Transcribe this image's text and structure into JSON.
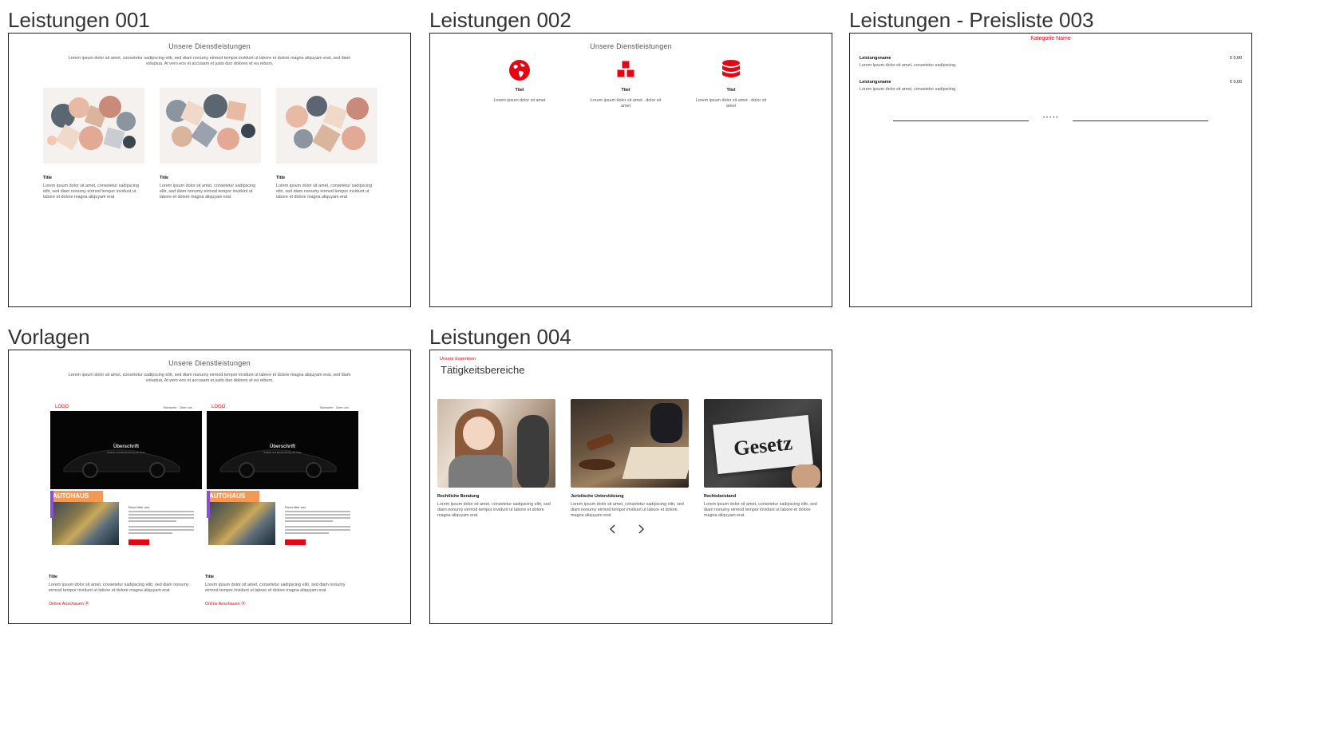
{
  "tiles": [
    {
      "title": "Leistungen 001"
    },
    {
      "title": "Leistungen 002"
    },
    {
      "title": "Leistungen - Preisliste 003"
    },
    {
      "title": "Vorlagen"
    },
    {
      "title": "Leistungen 004"
    }
  ],
  "l001": {
    "heading": "Unsere Dienstleistungen",
    "intro": "Lorem ipsum dolor sit amet, consetetur sadipscing elitr, sed diam nonumy eirmod tempor invidunt ut labore et dolore magna aliquyam erat, sed diam voluptua. At vero eos et accusam et justo duo dolores et ea rebum.",
    "cards": [
      {
        "title": "Title",
        "text": "Lorem ipsum dolor sit amet, consetetur sadipscing elitr, sed diam nonumy eirmod tempor invidunt ut labore et dolore magna aliquyam erat"
      },
      {
        "title": "Title",
        "text": "Lorem ipsum dolor sit amet, consetetur sadipscing elitr, sed diam nonumy eirmod tempor invidunt ut labore et dolore magna aliquyam erat"
      },
      {
        "title": "Title",
        "text": "Lorem ipsum dolor sit amet, consetetur sadipscing elitr, sed diam nonumy eirmod tempor invidunt ut labore et dolore magna aliquyam erat"
      }
    ]
  },
  "l002": {
    "heading": "Unsere Dienstleistungen",
    "items": [
      {
        "icon": "globe-icon",
        "title": "Titel",
        "text": "Lorem ipsum dolor sit amet"
      },
      {
        "icon": "cubes-icon",
        "title": "Titel",
        "text": "Lorem ipsum dolor sit amet . dolor sit amet"
      },
      {
        "icon": "database-icon",
        "title": "Titel",
        "text": "Lorem ipsum dolor sit amet . dolor sit amet"
      }
    ]
  },
  "l003": {
    "category": "Kategorie Name",
    "rows": [
      {
        "name": "Leistungsname",
        "price": "€ 0,00",
        "text": "Lorem ipsum dolor sit amet, consetetur sadipscing."
      },
      {
        "name": "Leistungsname",
        "price": "€ 0,00",
        "text": "Lorem ipsum dolor sit amet, consetetur sadipscing."
      }
    ],
    "divider_mark": "* * * * *"
  },
  "vorlagen": {
    "heading": "Unsere Dienstleistungen",
    "intro": "Lorem ipsum dolor sit amet, consetetur sadipscing elitr, sed diam nonumy eirmod tempor invidunt ut labore et dolore magna aliquyam erat, sed diam voluptua. At vero eos et accusam et justo duo dolores et ea rebum.",
    "cards": [
      {
        "logo": "LOGO",
        "nav1": "Startseite",
        "nav2": "Über uns",
        "hero": "Überschrift",
        "hero_sub": "Subtitel und Beschreibung der Seite",
        "badge": "AUTOHAUS",
        "side_title": "Rund über uns",
        "title": "Title",
        "text": "Lorem ipsum dolor sit amet, consetetur sadipscing elitr, sed diam nonumy eirmod tempor invidunt ut labore et dolore magna aliquyam erat",
        "link": "Online Anschauen ⦿"
      },
      {
        "logo": "LOGO",
        "nav1": "Startseite",
        "nav2": "Über uns",
        "hero": "Überschrift",
        "hero_sub": "Subtitel und Beschreibung der Seite",
        "badge": "AUTOHAUS",
        "side_title": "Rund über uns",
        "title": "Title",
        "text": "Lorem ipsum dolor sit amet, consetetur sadipscing elitr, sed diam nonumy eirmod tempor invidunt ut labore et dolore magna aliquyam erat",
        "link": "Online Anschauen ⦿"
      }
    ]
  },
  "l004": {
    "kicker": "Unsere Expertisen",
    "heading": "Tätigkeitsbereiche",
    "cards": [
      {
        "title": "Rechtliche Beratung",
        "text": "Lorem ipsum dolor sit amet, consetetur sadipscing elitr, sed diam nonumy eirmod tempor invidunt ut labore et dolore magna aliquyam erat"
      },
      {
        "title": "Juristische Unterstützung",
        "text": "Lorem ipsum dolor sit amet, consetetur sadipscing elitr, sed diam nonumy eirmod tempor invidunt ut labore et dolore magna aliquyam erat"
      },
      {
        "title": "Rechtsbeistand",
        "text": "Lorem ipsum dolor sit amet, consetetur sadipscing elitr, sed diam nonumy eirmod tempor invidunt ut labore et dolore magna aliquyam erat"
      }
    ],
    "sign_word": "Gesetz",
    "prev_icon": "chevron-left-icon",
    "next_icon": "chevron-right-icon"
  },
  "colors": {
    "accent": "#e30613",
    "border": "#222222",
    "orange": "#f29a55"
  }
}
